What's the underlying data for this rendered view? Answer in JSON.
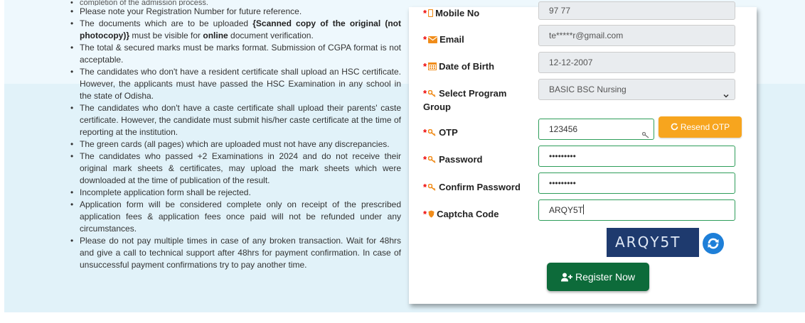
{
  "instructions": [
    {
      "text": "completion of the admission process."
    },
    {
      "text": "Please note your Registration Number for future reference."
    },
    {
      "pre": "The documents which are to be uploaded ",
      "bold1": "{Scanned copy of the original (not photocopy)}",
      "mid": " must be visible for ",
      "bold2": "online",
      "post": " document verification."
    },
    {
      "text": "The total & secured marks must be marks format. Submission of CGPA format is not acceptable."
    },
    {
      "text": "The candidates who don't have a resident certificate shall upload an HSC certificate. However, the applicants must have passed the HSC Examination in any school in the state of Odisha."
    },
    {
      "text": "The candidates who don't have a caste certificate shall upload their parents' caste certificate. However, the candidate must submit his/her caste certificate at the time of reporting at the institution."
    },
    {
      "text": "The green cards (all pages) which are uploaded must not have any discrepancies."
    },
    {
      "text": "The candidates who passed +2 Examinations in 2024 and do not receive their original mark sheets & certificates, may upload the mark sheets which were downloaded at the time of publication of the result."
    },
    {
      "text": "Incomplete application form shall be rejected."
    },
    {
      "text": "Application form will be considered complete only on receipt of the prescribed application fees & application fees once paid will not be refunded under any circumstances."
    },
    {
      "text": "Please do not pay multiple times in case of any broken transaction. Wait for 48hrs and give a call to technical support after 48hrs for payment confirmation. In case of unsuccessful payment confirmations try to pay another time."
    }
  ],
  "form": {
    "required_mark": "*",
    "mobile": {
      "label": "Mobile No",
      "value": "97      77"
    },
    "email": {
      "label": "Email",
      "value": "te*****r@gmail.com"
    },
    "dob": {
      "label": "Date of Birth",
      "value": "12-12-2007"
    },
    "program": {
      "label": "Select Program Group",
      "value": "BASIC BSC Nursing"
    },
    "otp": {
      "label": "OTP",
      "value": "123456"
    },
    "password": {
      "label": "Password",
      "value": "•••••••••"
    },
    "confirm_password": {
      "label": "Confirm Password",
      "value": "•••••••••"
    },
    "captcha": {
      "label": "Captcha Code",
      "value": "ARQY5T",
      "image_text": "ARQY5T"
    },
    "resend_otp_label": "Resend OTP",
    "register_label": "Register Now"
  },
  "colors": {
    "accent_orange": "#f7a51e",
    "register_green": "#0d6b3a",
    "required_red": "#e00000",
    "icon_orange": "#f08c1a",
    "active_border": "#2e9d5a"
  },
  "icons": {
    "mobile": "mobile-icon",
    "email": "envelope-icon",
    "dob": "calendar-icon",
    "program": "key-icon",
    "otp": "key-icon",
    "password": "key-icon",
    "confirm_password": "key-icon",
    "captcha": "shield-icon",
    "resend": "refresh-icon",
    "register": "user-plus-icon",
    "captcha_refresh": "refresh-icon"
  }
}
